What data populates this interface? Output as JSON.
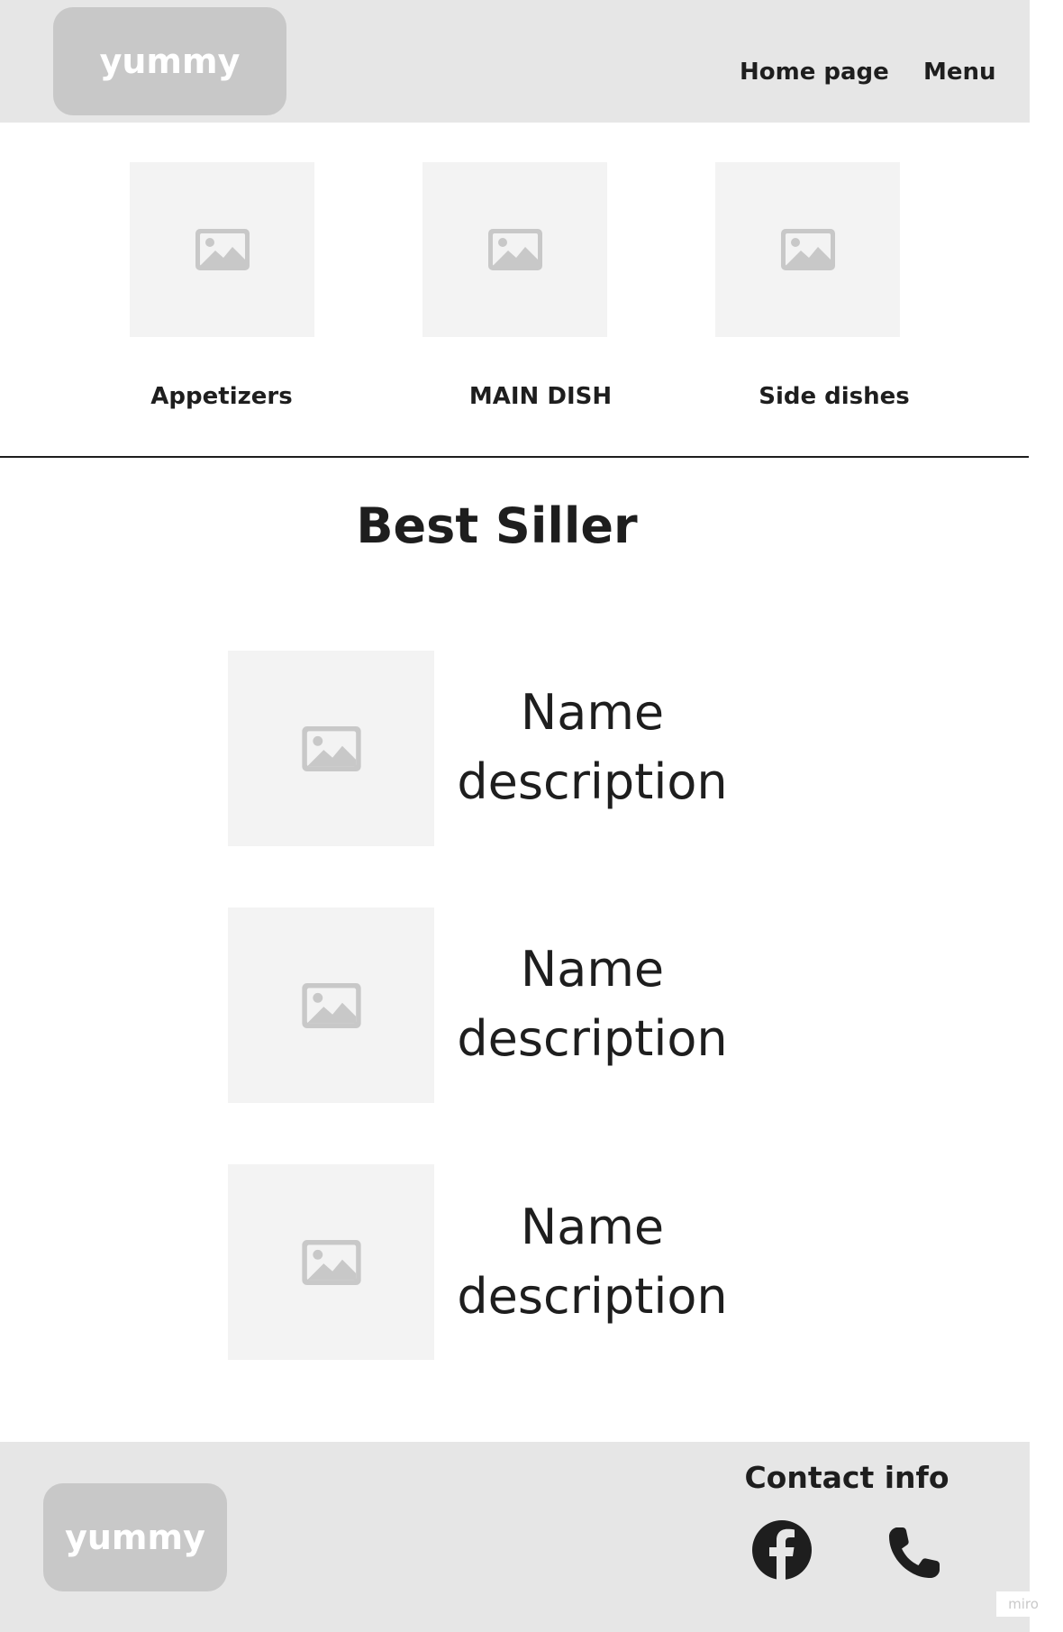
{
  "header": {
    "logo": "yummy",
    "nav": [
      "Home page",
      "Menu"
    ]
  },
  "categories": [
    {
      "label": "Appetizers"
    },
    {
      "label": "MAIN DISH"
    },
    {
      "label": "Side dishes"
    }
  ],
  "best_seller": {
    "title": "Best Siller",
    "items": [
      {
        "name": "Name",
        "description": "description"
      },
      {
        "name": "Name",
        "description": "description"
      },
      {
        "name": "Name",
        "description": "description"
      }
    ]
  },
  "footer": {
    "logo": "yummy",
    "contact_title": "Contact info",
    "icons": [
      "facebook-icon",
      "phone-icon"
    ]
  },
  "watermark": "miro",
  "colors": {
    "header_bg": "#e6e6e6",
    "logo_bg": "#c8c8c8",
    "placeholder_bg": "#f3f3f3",
    "placeholder_icon": "#c8c8c8",
    "text": "#1e1e1e"
  }
}
